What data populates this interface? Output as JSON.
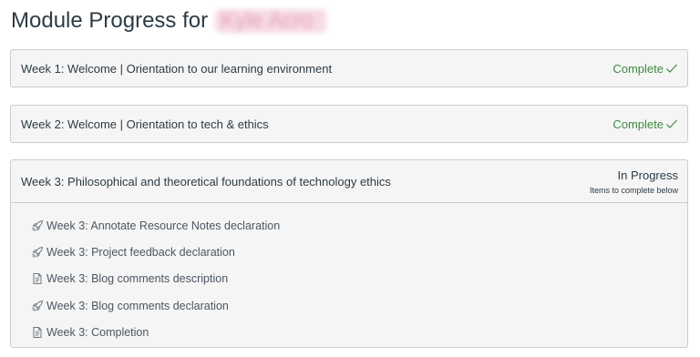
{
  "page": {
    "title": "Module Progress for",
    "student_name": "Kyle Acro"
  },
  "modules": [
    {
      "title": "Week 1: Welcome | Orientation to our learning environment",
      "status": "Complete"
    },
    {
      "title": "Week 2: Welcome | Orientation to tech & ethics",
      "status": "Complete"
    },
    {
      "title": "Week 3: Philosophical and theoretical foundations of technology ethics",
      "status": "In Progress",
      "status_note": "Items to complete below",
      "items": [
        {
          "icon": "rocket-icon",
          "label": "Week 3: Annotate Resource Notes declaration"
        },
        {
          "icon": "rocket-icon",
          "label": "Week 3: Project feedback declaration"
        },
        {
          "icon": "document-icon",
          "label": "Week 3: Blog comments description"
        },
        {
          "icon": "rocket-icon",
          "label": "Week 3: Blog comments declaration"
        },
        {
          "icon": "document-icon",
          "label": "Week 3: Completion"
        }
      ]
    }
  ],
  "colors": {
    "complete_text": "#3f8a3f",
    "text": "#2d3b45",
    "border": "#c7cdd1",
    "panel_bg": "#f5f5f5"
  }
}
